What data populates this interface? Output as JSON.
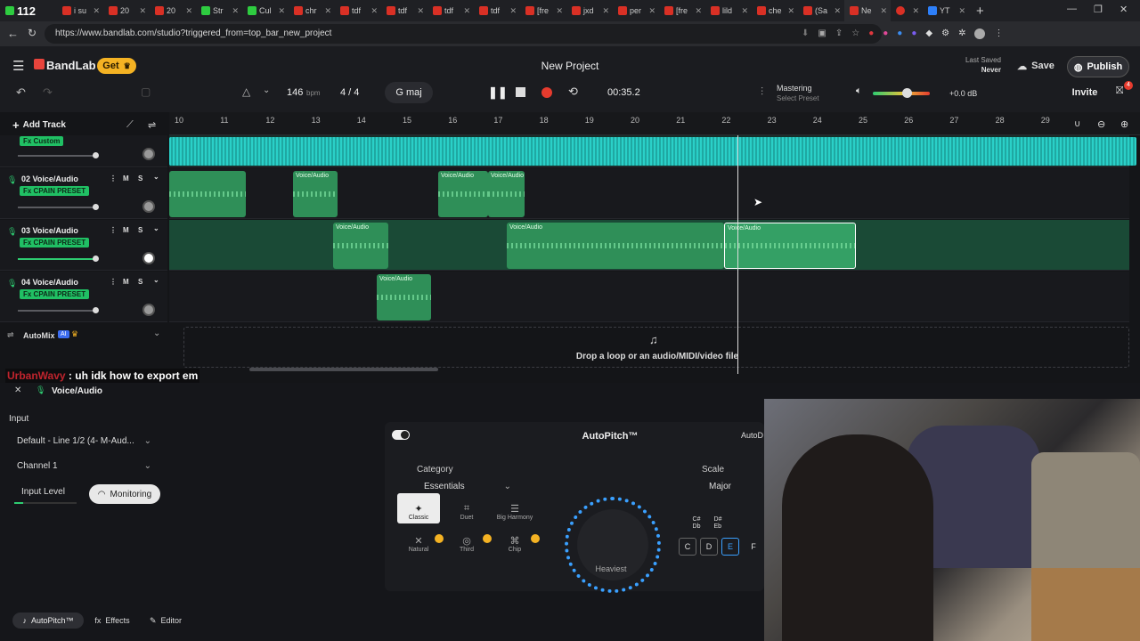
{
  "browser": {
    "tabs": [
      "112",
      "i su",
      "20",
      "20",
      "Str",
      "Cul",
      "chr",
      "tdf",
      "tdf",
      "tdf",
      "tdf",
      "[fre",
      "jxd",
      "per",
      "[fre",
      "lild",
      "che",
      "(Sa",
      "Ne",
      "",
      "YT"
    ],
    "url": "https://www.bandlab.com/studio?triggered_from=top_bar_new_project"
  },
  "header": {
    "logo": "BandLab",
    "get_label": "Get",
    "project_title": "New Project",
    "last_saved_label": "Last Saved",
    "last_saved_value": "Never",
    "save_label": "Save",
    "publish_label": "Publish",
    "invite_label": "Invite",
    "invite_badge": "4"
  },
  "transport": {
    "bpm": "146",
    "bpm_unit": "bpm",
    "time_signature": "4 / 4",
    "key": "G maj",
    "time": "00:35.2",
    "mastering_label": "Mastering",
    "mastering_preset": "Select Preset",
    "volume_db": "+0.0 dB",
    "volume_level": 0.6
  },
  "toolbar": {
    "add_track": "Add Track"
  },
  "ruler": [
    "10",
    "11",
    "12",
    "13",
    "14",
    "15",
    "16",
    "17",
    "18",
    "19",
    "20",
    "21",
    "22",
    "23",
    "24",
    "25",
    "26",
    "27",
    "28",
    "29"
  ],
  "tracks": [
    {
      "name": "",
      "preset": "Fx Custom"
    },
    {
      "name": "02  Voice/Audio",
      "preset": "Fx CPAIN PRESET"
    },
    {
      "name": "03  Voice/Audio",
      "preset": "Fx CPAIN PRESET"
    },
    {
      "name": "04  Voice/Audio",
      "preset": "Fx CPAIN PRESET"
    }
  ],
  "clip_label": "Voice/Audio",
  "automix": {
    "label": "AutoMix",
    "ai_badge": "AI"
  },
  "drop_zone": "Drop a loop or an audio/MIDI/video file",
  "chat": {
    "user": "UrbanWavy",
    "message": " : uh idk how to export em"
  },
  "panel": {
    "track_title": "Voice/Audio",
    "input_label": "Input",
    "input_device": "Default - Line 1/2 (4- M-Aud...",
    "channel": "Channel 1",
    "input_level_label": "Input Level",
    "monitoring_label": "Monitoring",
    "autopitch_title": "AutoPitch™",
    "autopitch_right": "AutoD",
    "category_label": "Category",
    "category_value": "Essentials",
    "presets": [
      {
        "label": "Classic"
      },
      {
        "label": "Duet"
      },
      {
        "label": "Big Harmony"
      },
      {
        "label": "Natural"
      },
      {
        "label": "Third"
      },
      {
        "label": "Chip"
      }
    ],
    "knob_label": "Heaviest",
    "scale_label": "Scale",
    "scale_value": "Major",
    "keys_top": [
      "C#\nDb",
      "D#\nEb"
    ],
    "keys": [
      "C",
      "D",
      "E",
      "F"
    ],
    "tabs": [
      "AutoPitch™",
      "Effects",
      "Editor"
    ]
  }
}
